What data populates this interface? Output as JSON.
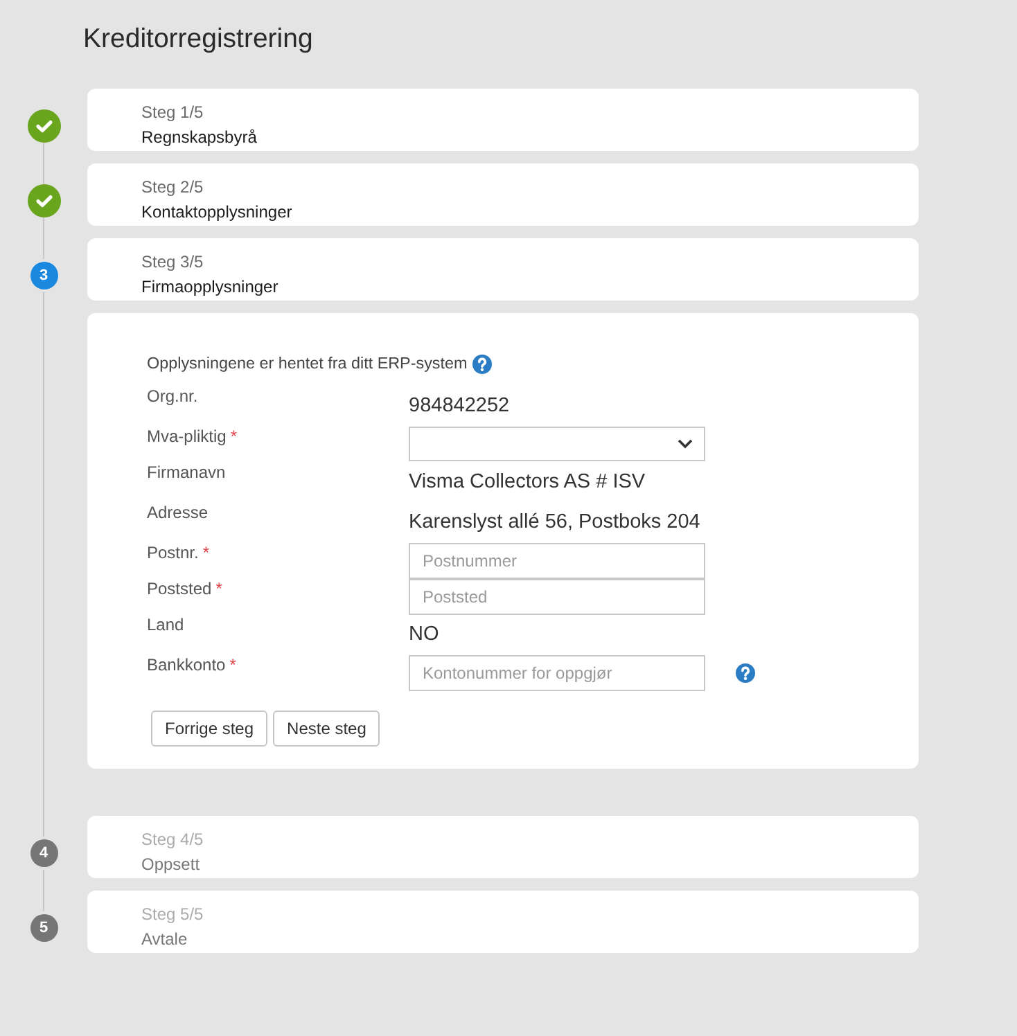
{
  "title": "Kreditorregistrering",
  "steps": [
    {
      "counter": "Steg 1/5",
      "title": "Regnskapsbyrå",
      "completed": true,
      "selected": false
    },
    {
      "counter": "Steg 2/5",
      "title": "Kontaktopplysninger",
      "completed": true,
      "selected": false
    },
    {
      "counter": "Steg 3/5",
      "title": "Firmaopplysninger",
      "completed": false,
      "selected": true,
      "number": "3",
      "form": {
        "info": {
          "text": "Opplysningene er hentet fra ditt ERP-system",
          "help": true
        },
        "fields": [
          {
            "label": "Org.nr.",
            "kind": "text",
            "value": "984842252"
          },
          {
            "label": "Mva-pliktig",
            "required_mark": "*",
            "kind": "select"
          },
          {
            "label": "Firmanavn",
            "kind": "text",
            "value": "Visma Collectors AS # ISV"
          },
          {
            "label": "Adresse",
            "kind": "text",
            "value": "Karenslyst allé 56, Postboks 204"
          },
          {
            "label": "Postnr.",
            "required_mark": "*",
            "kind": "input",
            "placeholder": "Postnummer"
          },
          {
            "label": "Poststed",
            "required_mark": "*",
            "kind": "input",
            "placeholder": "Poststed"
          },
          {
            "label": "Land",
            "kind": "text",
            "value": "NO"
          },
          {
            "label": "Bankkonto",
            "required_mark": "*",
            "kind": "input",
            "placeholder": "Kontonummer for oppgjør",
            "help": true
          }
        ],
        "buttons": [
          {
            "label": "Forrige steg"
          },
          {
            "label": "Neste steg"
          }
        ]
      }
    },
    {
      "counter": "Steg 4/5",
      "title": "Oppsett",
      "completed": false,
      "selected": false,
      "number": "4"
    },
    {
      "counter": "Steg 5/5",
      "title": "Avtale",
      "completed": false,
      "selected": false,
      "number": "5"
    }
  ]
}
